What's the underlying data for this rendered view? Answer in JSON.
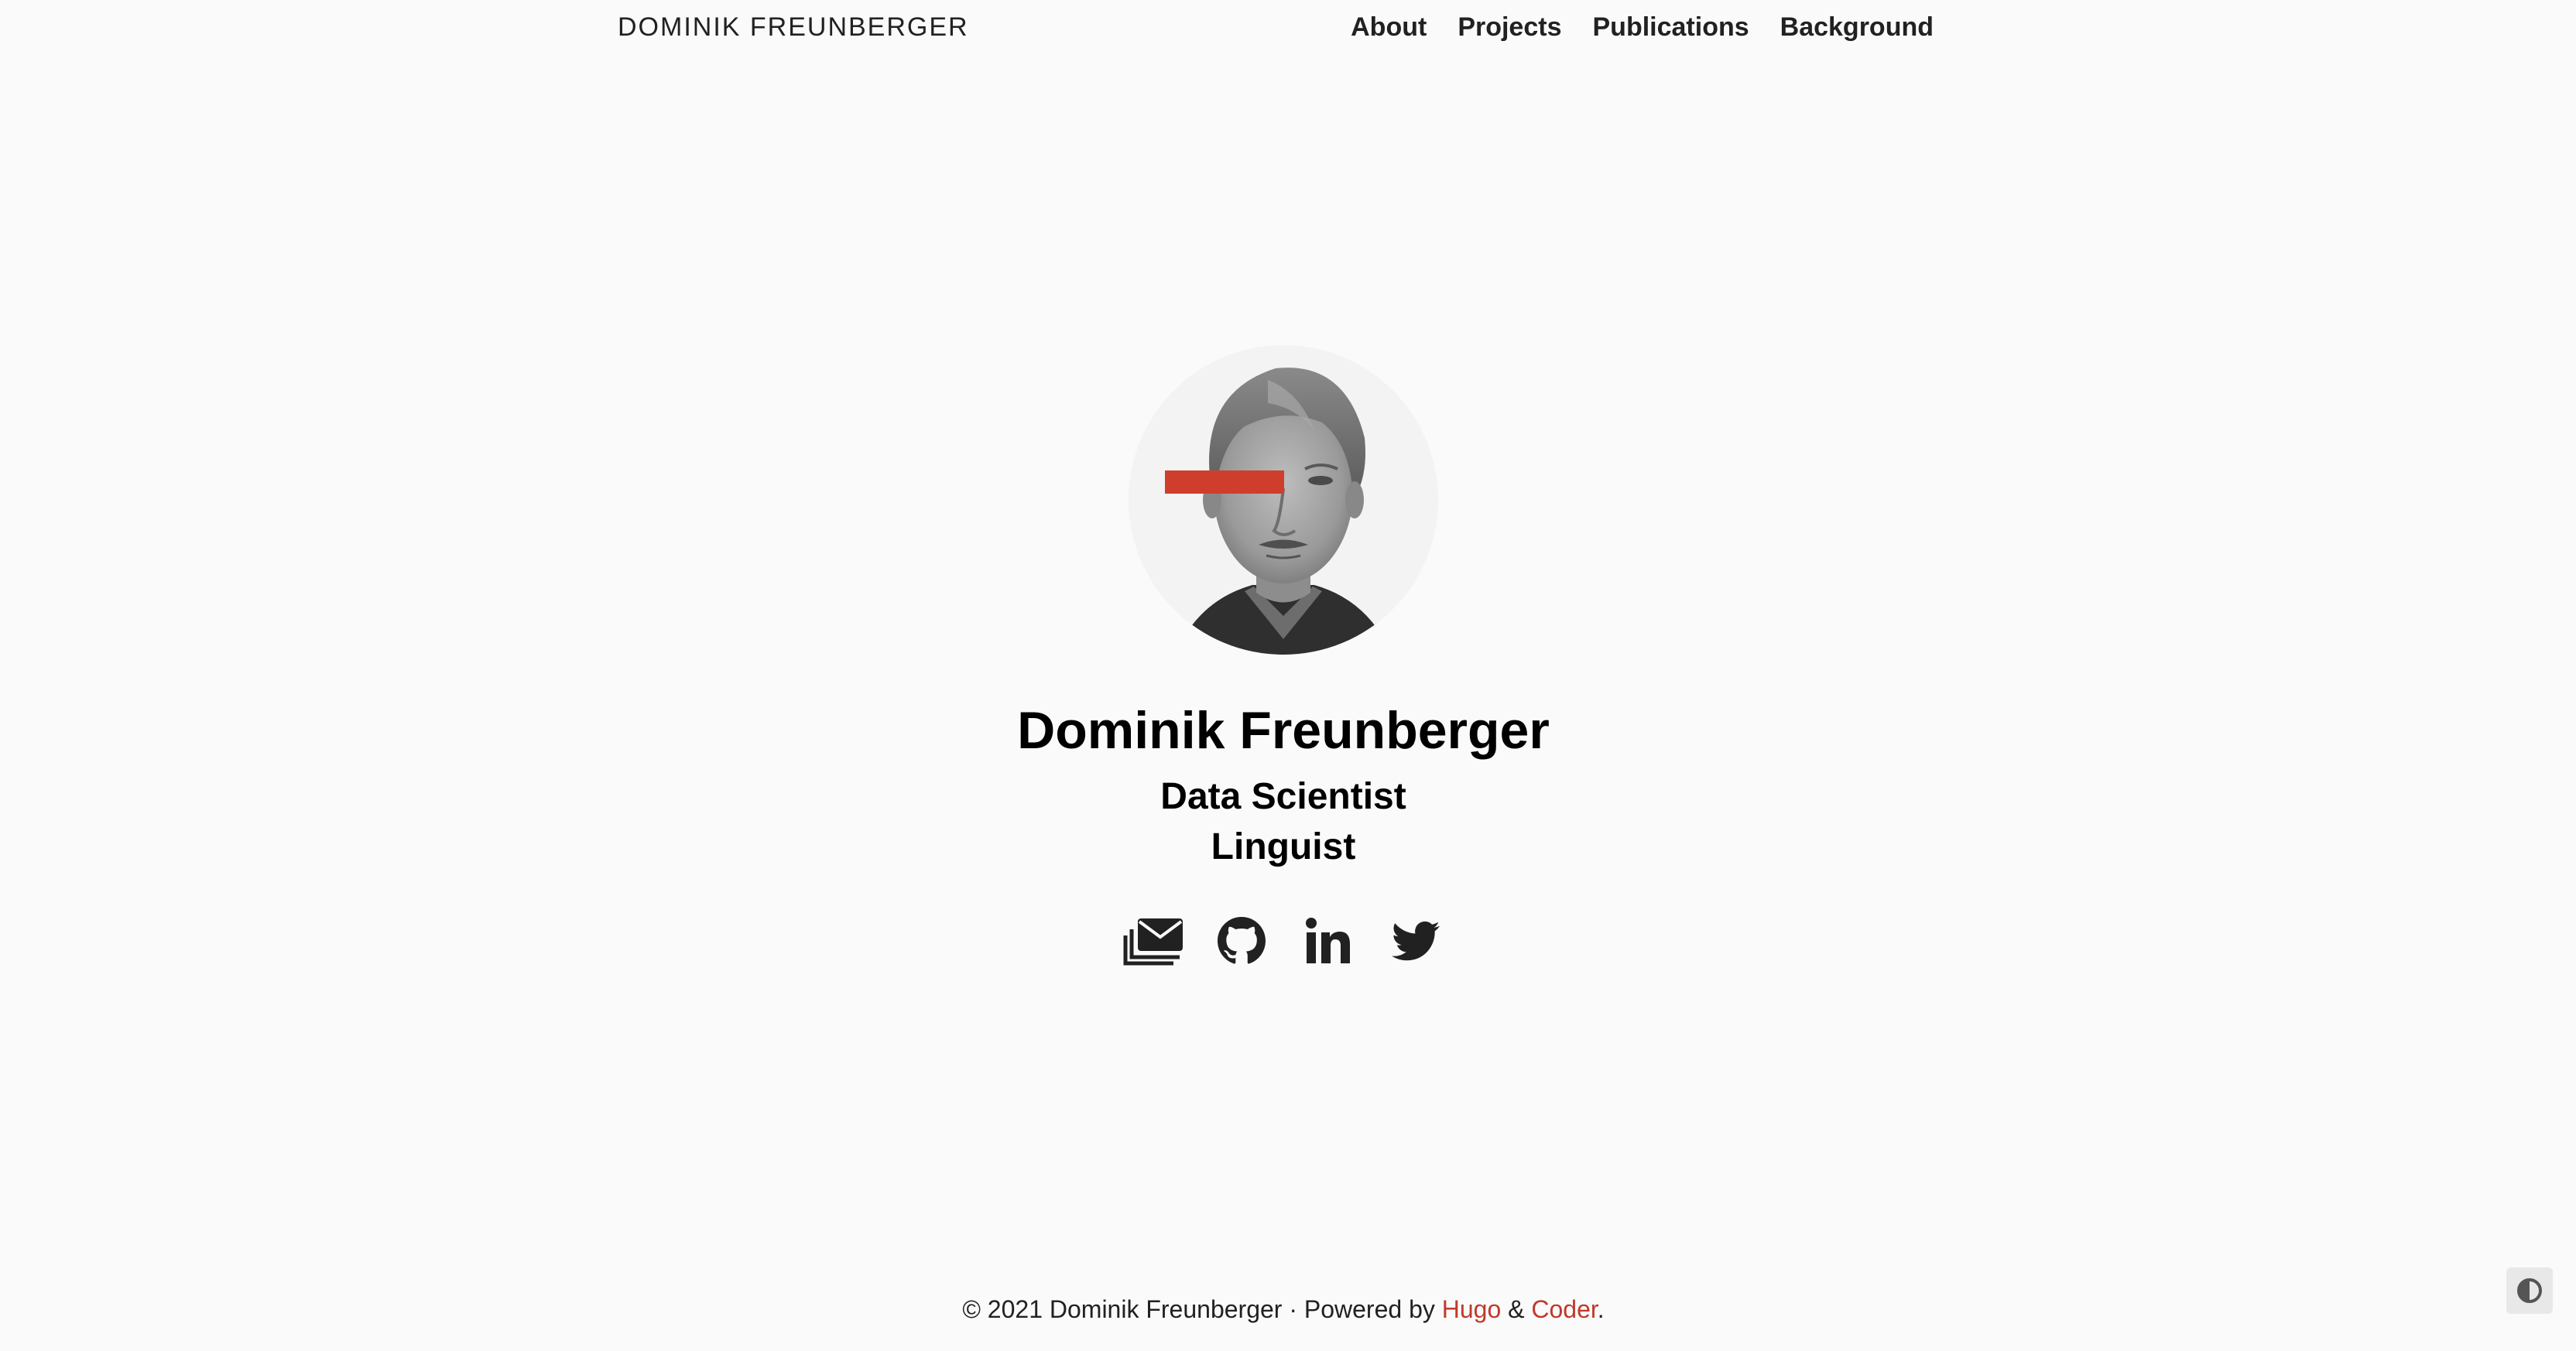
{
  "nav": {
    "brand": "DOMINIK FREUNBERGER",
    "links": [
      {
        "label": "About"
      },
      {
        "label": "Projects"
      },
      {
        "label": "Publications"
      },
      {
        "label": "Background"
      }
    ]
  },
  "profile": {
    "name": "Dominik Freunberger",
    "titles": [
      "Data Scientist",
      "Linguist"
    ],
    "avatar_icon": "portrait-photo",
    "accent_color": "#c0392b"
  },
  "social": [
    {
      "icon": "mail-stack-icon"
    },
    {
      "icon": "github-icon"
    },
    {
      "icon": "linkedin-icon"
    },
    {
      "icon": "twitter-icon"
    }
  ],
  "footer": {
    "prefix": "© 2021 Dominik Freunberger · Powered by ",
    "hugo": "Hugo",
    "amp": " & ",
    "coder": "Coder",
    "suffix": ".",
    "link_color": "#c0392b"
  },
  "theme_toggle": {
    "icon": "contrast-icon"
  }
}
